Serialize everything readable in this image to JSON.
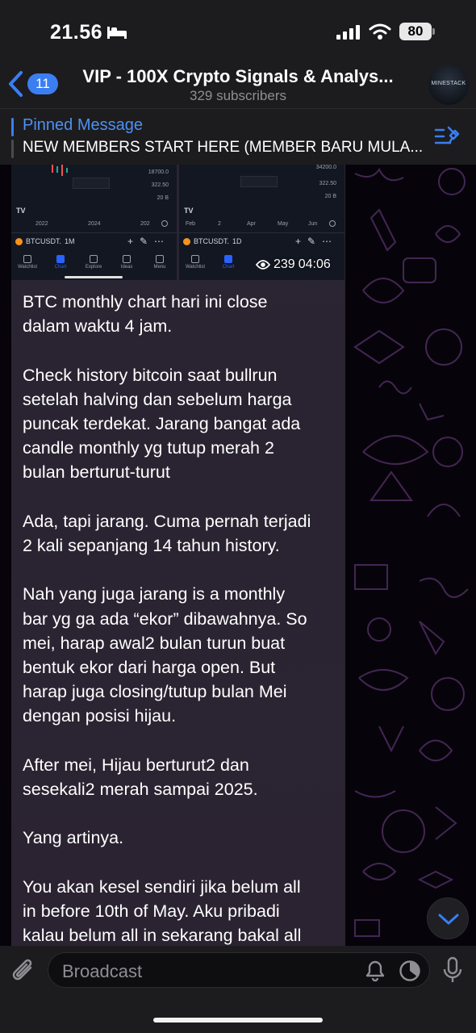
{
  "status_bar": {
    "time": "21.56",
    "battery": "80"
  },
  "header": {
    "back_badge": "11",
    "title": "VIP - 100X Crypto Signals & Analys...",
    "subtitle": "329 subscribers",
    "avatar_text": "MINESTACK"
  },
  "pinned": {
    "label": "Pinned Message",
    "text": "NEW MEMBERS START HERE (MEMBER BARU MULA..."
  },
  "message": {
    "screenshot_left": {
      "prices": [
        "18700.0",
        "322.50",
        "20 B"
      ],
      "axis": [
        "2022",
        "2024",
        "202"
      ],
      "symbol": "BTCUSDT.",
      "timeframe": "1M",
      "tabs": [
        "Watchlist",
        "Chart",
        "Explore",
        "Ideas",
        "Menu"
      ]
    },
    "screenshot_right": {
      "prices": [
        "34200.0",
        "322.50",
        "20 B"
      ],
      "axis": [
        "Feb",
        "2",
        "Apr",
        "May",
        "Jun"
      ],
      "symbol": "BTCUSDT.",
      "timeframe": "1D",
      "tabs": [
        "Watchlist",
        "Chart"
      ]
    },
    "views": "239",
    "time": "04:06",
    "text": "BTC monthly chart hari ini close\ndalam waktu 4 jam.\n\nCheck history bitcoin saat bullrun\nsetelah halving dan sebelum harga\npuncak terdekat. Jarang bangat ada\ncandle monthly yg tutup merah 2\nbulan berturut-turut\n\nAda, tapi jarang. Cuma pernah terjadi\n2 kali sepanjang 14 tahun history.\n\nNah yang juga jarang is a monthly\nbar yg ga ada “ekor” dibawahnya. So\nmei, harap awal2 bulan turun buat\nbentuk ekor dari harga open. But\nharap juga closing/tutup bulan Mei\ndengan posisi hijau.\n\nAfter mei, Hijau berturut2 dan\nsesekali2 merah sampai 2025.\n\nYang artinya.\n\nYou akan kesel sendiri jika belum all\nin before 10th of May. Aku pribadi\nkalau belum all in sekarang bakal all"
  },
  "input": {
    "placeholder": "Broadcast"
  },
  "colors": {
    "accent": "#3b7ef2",
    "bubble": "#2a2532",
    "bar": "#1c1c1e"
  }
}
